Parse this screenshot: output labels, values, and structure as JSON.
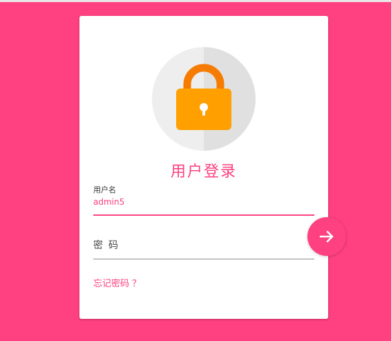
{
  "login": {
    "title": "用户登录",
    "username_label": "用户名",
    "username_value": "admin5",
    "password_label": "密码",
    "forgot_link": "忘记密码 ？"
  },
  "icons": {
    "lock": "lock-icon",
    "submit": "arrow-right-icon"
  },
  "colors": {
    "background": "#ff4081",
    "accent": "#ff4081",
    "lock_body": "#ffa000",
    "lock_shackle": "#f57c00",
    "card": "#ffffff"
  }
}
